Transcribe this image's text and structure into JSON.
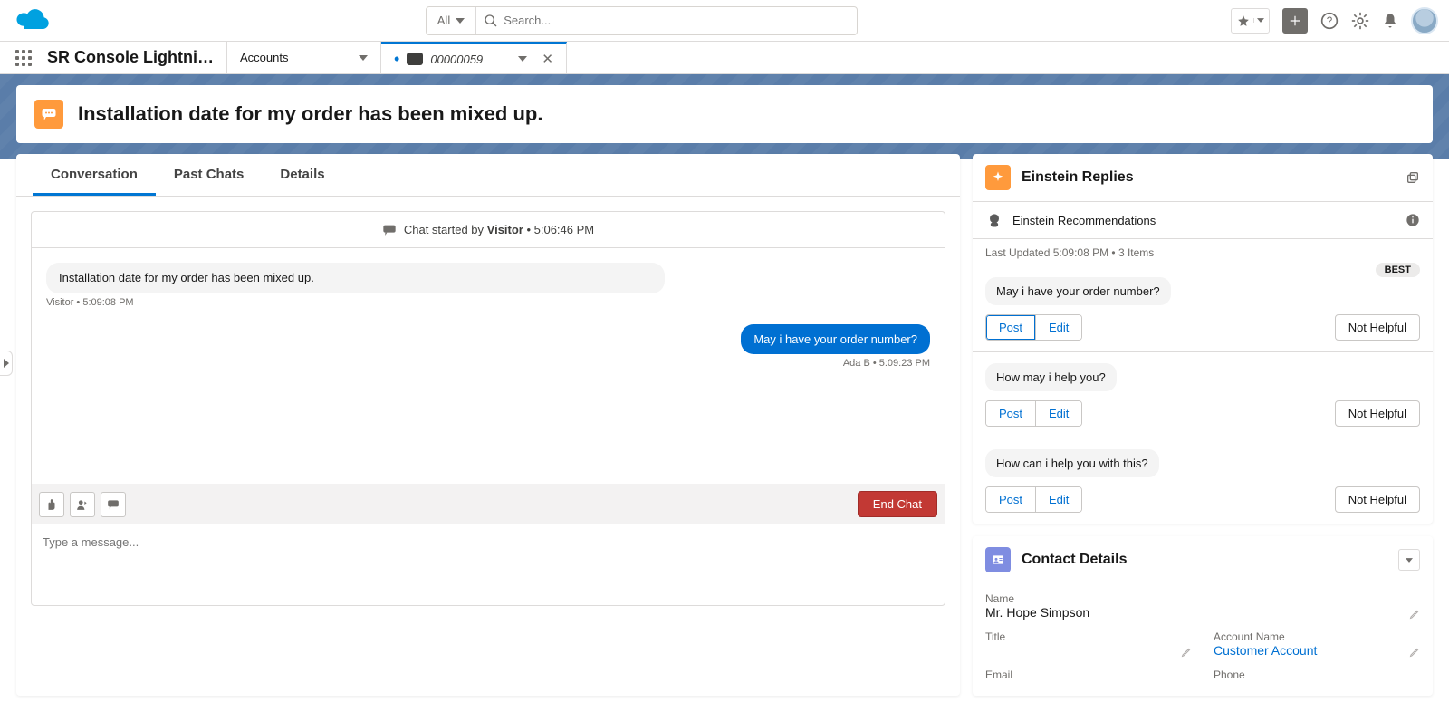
{
  "header": {
    "search_scope": "All",
    "search_placeholder": "Search..."
  },
  "nav": {
    "app_name": "SR Console Lightni…",
    "object_tab_label": "Accounts",
    "record_tab_label": "00000059"
  },
  "case": {
    "title": "Installation date for my order has been mixed up."
  },
  "tabs": {
    "conversation": "Conversation",
    "past_chats": "Past Chats",
    "details": "Details"
  },
  "chat": {
    "started_prefix": "Chat started by ",
    "started_by": "Visitor",
    "started_at_suffix": " • 5:06:46 PM",
    "messages": {
      "m1_text": "Installation date for my order has been mixed up.",
      "m1_meta": "Visitor • 5:09:08 PM",
      "m2_text": "May i have your order number?",
      "m2_meta": "Ada B • 5:09:23 PM"
    },
    "compose_placeholder": "Type a message...",
    "end_label": "End Chat"
  },
  "einstein": {
    "title": "Einstein Replies",
    "sub_title": "Einstein Recommendations",
    "last_updated": "Last Updated 5:09:08 PM • 3 Items",
    "best_label": "BEST",
    "replies": {
      "r1": "May i have your order number?",
      "r2": "How may i help you?",
      "r3": "How can i help you with this?"
    },
    "post_label": "Post",
    "edit_label": "Edit",
    "not_helpful_label": "Not Helpful"
  },
  "contact": {
    "title": "Contact Details",
    "name_label": "Name",
    "name_value": "Mr. Hope Simpson",
    "title_label": "Title",
    "title_value": "",
    "account_label": "Account Name",
    "account_value": "Customer Account",
    "email_label": "Email",
    "phone_label": "Phone"
  }
}
